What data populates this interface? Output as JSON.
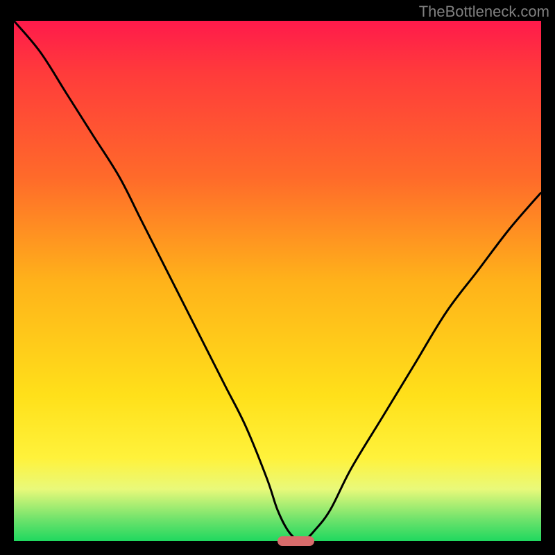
{
  "watermark": "TheBottleneck.com",
  "chart_data": {
    "type": "line",
    "title": "",
    "xlabel": "",
    "ylabel": "",
    "xlim": [
      0,
      100
    ],
    "ylim": [
      0,
      100
    ],
    "series": [
      {
        "name": "curve",
        "x": [
          0,
          5,
          10,
          15,
          20,
          24,
          28,
          32,
          36,
          40,
          44,
          48,
          50,
          52,
          54,
          55,
          57,
          60,
          64,
          70,
          76,
          82,
          88,
          94,
          100
        ],
        "y": [
          100,
          94,
          86,
          78,
          70,
          62,
          54,
          46,
          38,
          30,
          22,
          12,
          6,
          2,
          0,
          0,
          2,
          6,
          14,
          24,
          34,
          44,
          52,
          60,
          67
        ]
      }
    ],
    "min_marker": {
      "x_start": 50,
      "x_end": 57,
      "y": 0
    },
    "gradient_stops": [
      {
        "pct": 0,
        "color": "#ff1a4b"
      },
      {
        "pct": 10,
        "color": "#ff3b3b"
      },
      {
        "pct": 30,
        "color": "#ff6a2a"
      },
      {
        "pct": 50,
        "color": "#ffb21a"
      },
      {
        "pct": 72,
        "color": "#ffe01a"
      },
      {
        "pct": 84,
        "color": "#fff23b"
      },
      {
        "pct": 90,
        "color": "#e9f97a"
      },
      {
        "pct": 96,
        "color": "#6be26b"
      },
      {
        "pct": 100,
        "color": "#1fd85f"
      }
    ]
  }
}
